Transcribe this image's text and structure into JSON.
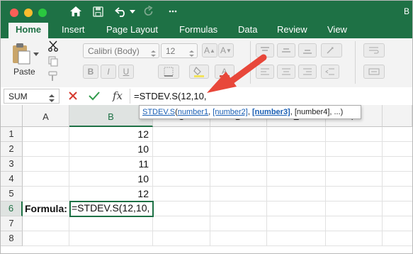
{
  "window": {
    "title_fragment": "B"
  },
  "quick_access": {
    "icons": [
      "home-icon",
      "save-icon",
      "undo-icon",
      "undo-dropdown-icon",
      "redo-icon",
      "customize-icon"
    ]
  },
  "tabs": [
    {
      "label": "Home",
      "active": true
    },
    {
      "label": "Insert",
      "active": false
    },
    {
      "label": "Page Layout",
      "active": false
    },
    {
      "label": "Formulas",
      "active": false
    },
    {
      "label": "Data",
      "active": false
    },
    {
      "label": "Review",
      "active": false
    },
    {
      "label": "View",
      "active": false
    }
  ],
  "ribbon": {
    "paste_label": "Paste",
    "font_name": "Calibri (Body)",
    "font_size": "12",
    "bold": "B",
    "italic": "I",
    "underline": "U"
  },
  "formula_bar": {
    "name_box": "SUM",
    "fx_label": "fx",
    "formula": "=STDEV.S(12,10,"
  },
  "tooltip": {
    "func": "STDEV.S",
    "open": "(",
    "arg1": "number1",
    "arg2": "[number2]",
    "arg3": "[number3]",
    "arg4": "[number4]",
    "ellipsis": "...",
    "close": ")",
    "sep": ", "
  },
  "grid": {
    "columns": [
      "A",
      "B",
      "C",
      "D",
      "E",
      "F"
    ],
    "rows": [
      "1",
      "2",
      "3",
      "4",
      "5",
      "6",
      "7",
      "8"
    ],
    "b_values": [
      "12",
      "10",
      "11",
      "10",
      "12"
    ],
    "a6_label": "Formula:",
    "b6_edit": "=STDEV.S(12,10,"
  },
  "colors": {
    "accent": "#1e7145",
    "arrow": "#e8473a",
    "link": "#1a5fb4"
  }
}
